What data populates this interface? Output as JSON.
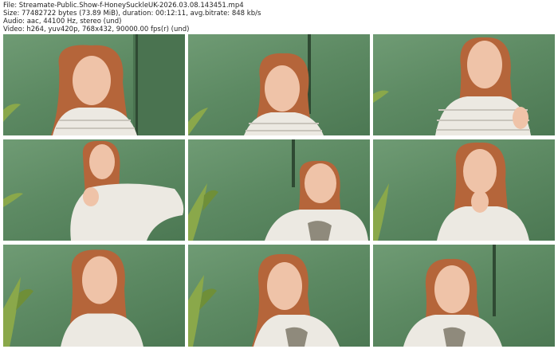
{
  "header": {
    "file_line": "File: Streamate-Public.Show-f-HoneySuckleUK-2026.03.08.143451.mp4",
    "size_line": "Size: 77482722 bytes (73.89 MiB), duration: 00:12:11, avg.bitrate: 848 kb/s",
    "audio_line": "Audio: aac, 44100 Hz, stereo (und)",
    "video_line": "Video: h264, yuv420p, 768x432, 90000.00 fps(r) (und)"
  },
  "colors": {
    "wall_green": "#5d8a63",
    "hair": "#b5653a",
    "skin": "#efc3a8",
    "sweater": "#ece9e2"
  },
  "thumbnails": [
    {
      "pose": "woman-center-looking-down"
    },
    {
      "pose": "woman-center-slight-smile"
    },
    {
      "pose": "woman-right-talking"
    },
    {
      "pose": "woman-adjusting-sweater"
    },
    {
      "pose": "woman-center-eyes-closed"
    },
    {
      "pose": "woman-hand-to-mouth"
    },
    {
      "pose": "woman-left-talking"
    },
    {
      "pose": "woman-center-smiling"
    },
    {
      "pose": "woman-right-leaning"
    }
  ]
}
